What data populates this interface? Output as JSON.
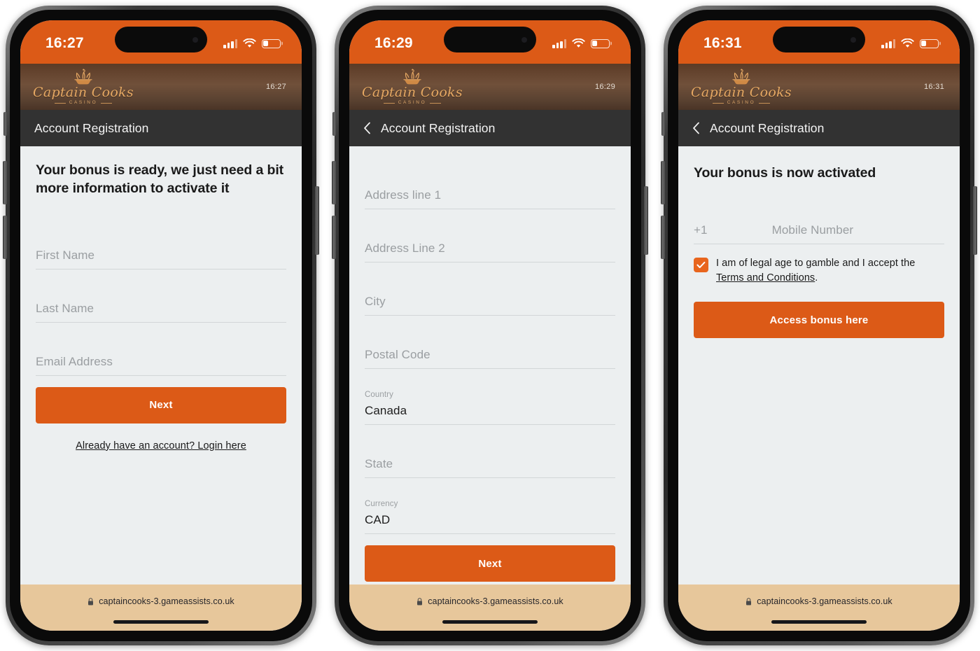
{
  "brand": {
    "name": "Captain Cooks",
    "subtitle": "CASINO",
    "accent_color": "#dc5a17",
    "brandbar_color": "#5c3b26",
    "urlbar_color": "#e7c79b"
  },
  "url_bar": {
    "lock_icon": "lock-icon",
    "url": "captaincooks-3.gameassists.co.uk"
  },
  "phones": [
    {
      "status_bar": {
        "time": "16:27",
        "cellular_icon": "cellular-bars-icon",
        "wifi_icon": "wifi-icon",
        "battery_icon": "battery-low-icon"
      },
      "brand_time": "16:27",
      "title_bar": {
        "title": "Account Registration",
        "has_back": false,
        "back_icon": "chevron-left-icon"
      },
      "headline": "Your bonus is ready, we just need a bit more information to activate it",
      "fields": [
        {
          "placeholder": "First Name",
          "value": "",
          "label": ""
        },
        {
          "placeholder": "Last Name",
          "value": "",
          "label": ""
        },
        {
          "placeholder": "Email Address",
          "value": "",
          "label": ""
        }
      ],
      "primary_button": "Next",
      "login_link": "Already have an account? Login here"
    },
    {
      "status_bar": {
        "time": "16:29",
        "cellular_icon": "cellular-bars-icon",
        "wifi_icon": "wifi-icon",
        "battery_icon": "battery-low-icon"
      },
      "brand_time": "16:29",
      "title_bar": {
        "title": "Account Registration",
        "has_back": true,
        "back_icon": "chevron-left-icon"
      },
      "fields": [
        {
          "placeholder": "Address line 1",
          "value": "",
          "label": ""
        },
        {
          "placeholder": "Address Line 2",
          "value": "",
          "label": ""
        },
        {
          "placeholder": "City",
          "value": "",
          "label": ""
        },
        {
          "placeholder": "Postal Code",
          "value": "",
          "label": ""
        },
        {
          "placeholder": "",
          "value": "Canada",
          "label": "Country"
        },
        {
          "placeholder": "State",
          "value": "",
          "label": ""
        },
        {
          "placeholder": "",
          "value": "CAD",
          "label": "Currency"
        }
      ],
      "primary_button": "Next"
    },
    {
      "status_bar": {
        "time": "16:31",
        "cellular_icon": "cellular-bars-icon",
        "wifi_icon": "wifi-icon",
        "battery_icon": "battery-low-icon"
      },
      "brand_time": "16:31",
      "title_bar": {
        "title": "Account Registration",
        "has_back": true,
        "back_icon": "chevron-left-icon"
      },
      "headline": "Your bonus is now activated",
      "mobile": {
        "prefix": "+1",
        "placeholder": "Mobile Number",
        "value": ""
      },
      "terms": {
        "checked": true,
        "checkbox_icon": "checkmark-icon",
        "text_before": "I am of legal age to gamble and I accept the ",
        "link_text": "Terms and Conditions",
        "text_after": "."
      },
      "primary_button": "Access bonus here"
    }
  ]
}
